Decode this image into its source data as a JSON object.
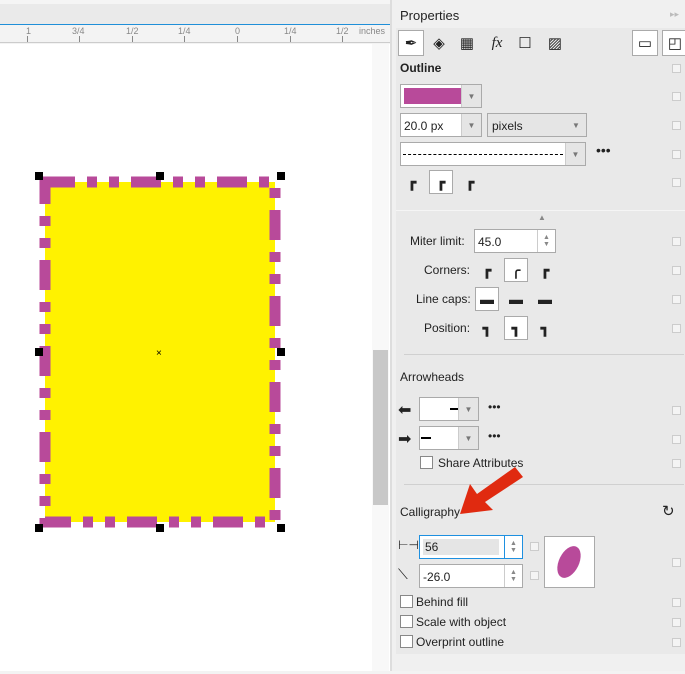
{
  "ruler": {
    "labels": [
      "1",
      "3/4",
      "1/2",
      "1/4",
      "0",
      "1/4",
      "1/2"
    ],
    "unit": "inches"
  },
  "colors": {
    "outline": "#b84a9a",
    "fill": "#fff200",
    "arrow": "#e02a10"
  },
  "panel": {
    "title": "Properties",
    "tabs": [
      "outline-pen",
      "fill",
      "transparency",
      "effects",
      "frame",
      "image-help"
    ],
    "outline": {
      "heading": "Outline",
      "width": "20.0 px",
      "units": "pixels",
      "miter_label": "Miter limit:",
      "miter": "45.0",
      "corners_label": "Corners:",
      "linecaps_label": "Line caps:",
      "position_label": "Position:"
    },
    "arrowheads": {
      "heading": "Arrowheads",
      "share": "Share Attributes"
    },
    "calligraphy": {
      "heading": "Calligraphy",
      "stretch": "56",
      "angle": "-26.0"
    },
    "options": [
      "Behind fill",
      "Scale with object",
      "Overprint outline"
    ]
  }
}
